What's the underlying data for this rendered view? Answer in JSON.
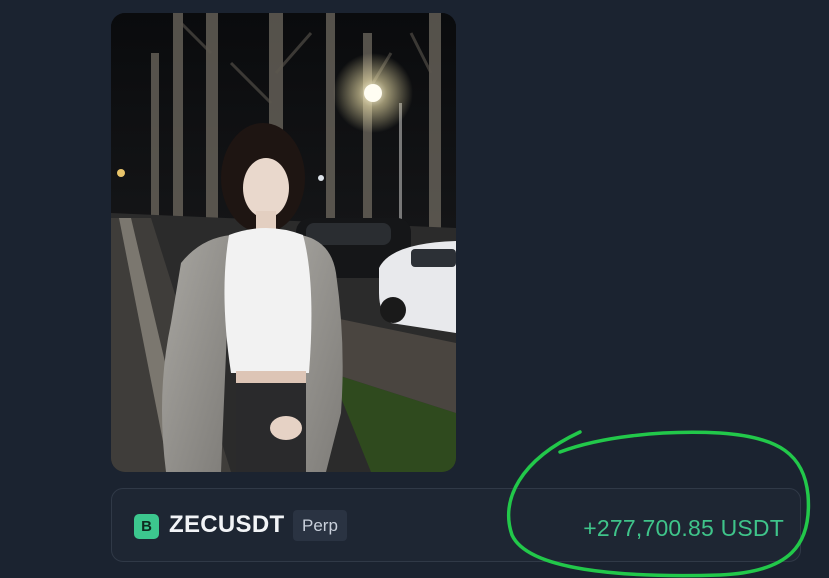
{
  "trade": {
    "exchange_icon_letter": "B",
    "symbol": "ZECUSDT",
    "market_type": "Perp",
    "pnl": "+277,700.85 USDT"
  },
  "colors": {
    "background": "#1b2330",
    "profit_green": "#3fc48a",
    "annotation_green": "#22c84a",
    "badge_green": "#3cc78e"
  },
  "icons": {
    "exchange": "exchange-logo-icon"
  }
}
